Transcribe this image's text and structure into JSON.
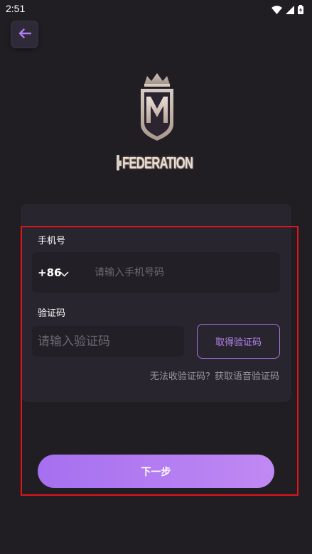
{
  "status_bar": {
    "time": "2:51",
    "icons": [
      "wifi-icon",
      "cellular-signal-icon",
      "battery-icon"
    ]
  },
  "header": {
    "back_icon": "arrow-left-icon"
  },
  "logo": {
    "brand_name": "FEDERATION"
  },
  "form": {
    "phone_label": "手机号",
    "country_code": "+86",
    "phone_placeholder": "请输入手机号码",
    "code_label": "验证码",
    "code_placeholder": "请输入验证码",
    "get_code_label": "取得验证码",
    "no_code_text": "无法收验证码？获取语音验证码",
    "next_label": "下一步"
  },
  "colors": {
    "background": "#201d23",
    "card": "#29252e",
    "input": "#221f27",
    "accent": "#a773e5",
    "button_gradient_start": "#a66ff0",
    "button_gradient_end": "#c089f3",
    "highlight_border": "#e0141c"
  }
}
